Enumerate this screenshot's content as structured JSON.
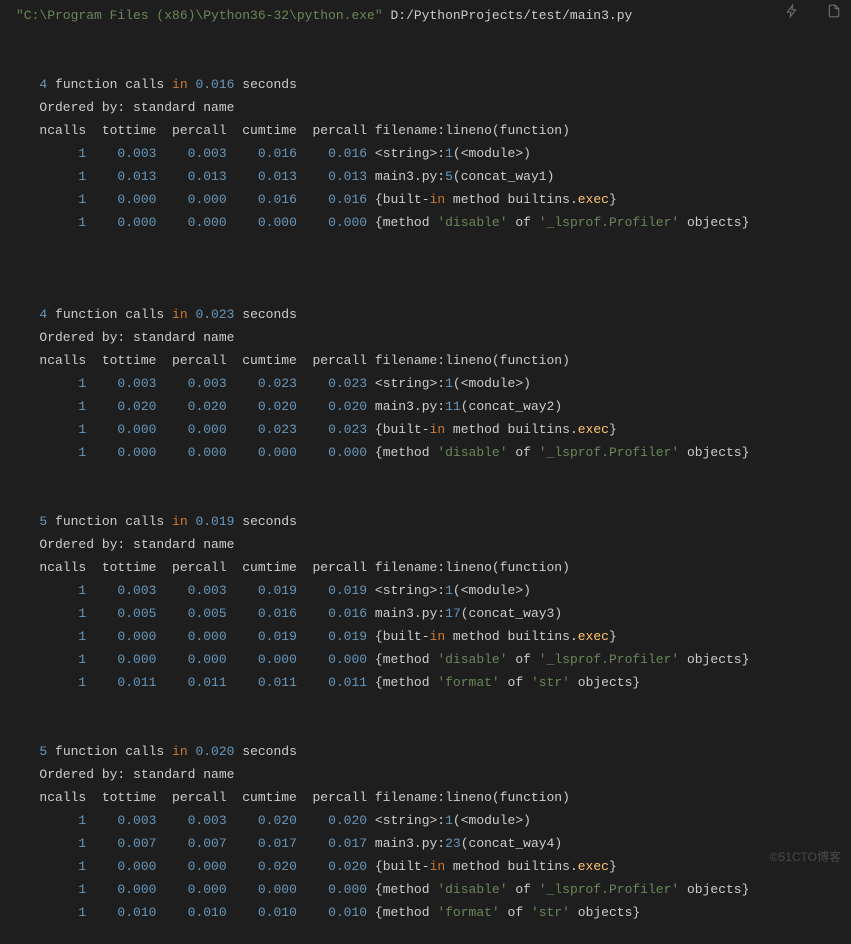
{
  "cmd": {
    "exe": "\"C:\\Program Files (x86)\\Python36-32\\python.exe\"",
    "arg": " D:/PythonProjects/test/main3.py"
  },
  "headers": {
    "ordered": "Ordered by: standard name",
    "cols": "ncalls  tottime  percall  cumtime  percall filename:lineno(function)",
    "calls_word": " function calls ",
    "in_word": "in",
    "seconds_word": " seconds"
  },
  "blocks": [
    {
      "count": "4",
      "time": "0.016",
      "rows": [
        {
          "n": "1",
          "tt": "0.003",
          "pc1": "0.003",
          "ct": "0.016",
          "pc2": "0.016",
          "type": "string",
          "lineno": "1",
          "func": "<module>"
        },
        {
          "n": "1",
          "tt": "0.013",
          "pc1": "0.013",
          "ct": "0.013",
          "pc2": "0.013",
          "type": "main",
          "lineno": "5",
          "func": "concat_way1"
        },
        {
          "n": "1",
          "tt": "0.000",
          "pc1": "0.000",
          "ct": "0.016",
          "pc2": "0.016",
          "type": "exec"
        },
        {
          "n": "1",
          "tt": "0.000",
          "pc1": "0.000",
          "ct": "0.000",
          "pc2": "0.000",
          "type": "disable"
        }
      ]
    },
    {
      "count": "4",
      "time": "0.023",
      "rows": [
        {
          "n": "1",
          "tt": "0.003",
          "pc1": "0.003",
          "ct": "0.023",
          "pc2": "0.023",
          "type": "string",
          "lineno": "1",
          "func": "<module>"
        },
        {
          "n": "1",
          "tt": "0.020",
          "pc1": "0.020",
          "ct": "0.020",
          "pc2": "0.020",
          "type": "main",
          "lineno": "11",
          "func": "concat_way2"
        },
        {
          "n": "1",
          "tt": "0.000",
          "pc1": "0.000",
          "ct": "0.023",
          "pc2": "0.023",
          "type": "exec"
        },
        {
          "n": "1",
          "tt": "0.000",
          "pc1": "0.000",
          "ct": "0.000",
          "pc2": "0.000",
          "type": "disable"
        }
      ]
    },
    {
      "count": "5",
      "time": "0.019",
      "rows": [
        {
          "n": "1",
          "tt": "0.003",
          "pc1": "0.003",
          "ct": "0.019",
          "pc2": "0.019",
          "type": "string",
          "lineno": "1",
          "func": "<module>"
        },
        {
          "n": "1",
          "tt": "0.005",
          "pc1": "0.005",
          "ct": "0.016",
          "pc2": "0.016",
          "type": "main",
          "lineno": "17",
          "func": "concat_way3"
        },
        {
          "n": "1",
          "tt": "0.000",
          "pc1": "0.000",
          "ct": "0.019",
          "pc2": "0.019",
          "type": "exec"
        },
        {
          "n": "1",
          "tt": "0.000",
          "pc1": "0.000",
          "ct": "0.000",
          "pc2": "0.000",
          "type": "disable"
        },
        {
          "n": "1",
          "tt": "0.011",
          "pc1": "0.011",
          "ct": "0.011",
          "pc2": "0.011",
          "type": "format"
        }
      ]
    },
    {
      "count": "5",
      "time": "0.020",
      "rows": [
        {
          "n": "1",
          "tt": "0.003",
          "pc1": "0.003",
          "ct": "0.020",
          "pc2": "0.020",
          "type": "string",
          "lineno": "1",
          "func": "<module>"
        },
        {
          "n": "1",
          "tt": "0.007",
          "pc1": "0.007",
          "ct": "0.017",
          "pc2": "0.017",
          "type": "main",
          "lineno": "23",
          "func": "concat_way4"
        },
        {
          "n": "1",
          "tt": "0.000",
          "pc1": "0.000",
          "ct": "0.020",
          "pc2": "0.020",
          "type": "exec"
        },
        {
          "n": "1",
          "tt": "0.000",
          "pc1": "0.000",
          "ct": "0.000",
          "pc2": "0.000",
          "type": "disable"
        },
        {
          "n": "1",
          "tt": "0.010",
          "pc1": "0.010",
          "ct": "0.010",
          "pc2": "0.010",
          "type": "format"
        }
      ]
    }
  ],
  "watermark": "©51CTO博客"
}
